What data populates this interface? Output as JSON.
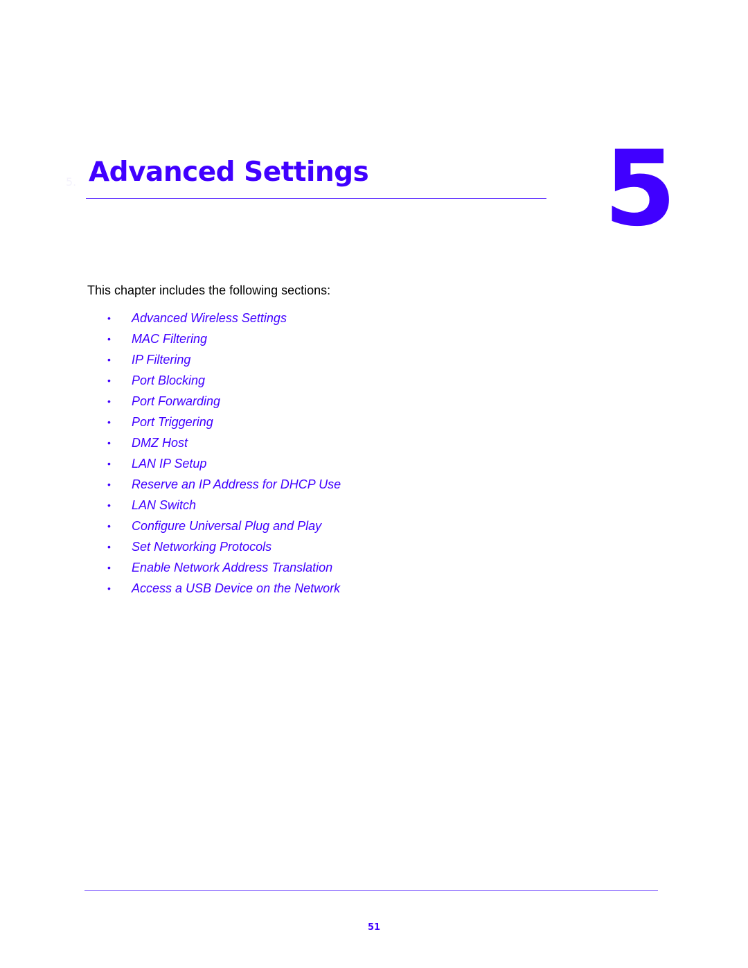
{
  "chapter": {
    "number_label": "5.",
    "title": "Advanced Settings",
    "big_number": "5"
  },
  "intro_text": "This chapter includes the following sections:",
  "toc": [
    {
      "bullet": "•",
      "label": "Advanced Wireless Settings"
    },
    {
      "bullet": "•",
      "label": "MAC Filtering"
    },
    {
      "bullet": "•",
      "label": "IP Filtering"
    },
    {
      "bullet": "•",
      "label": "Port Blocking"
    },
    {
      "bullet": "•",
      "label": "Port Forwarding"
    },
    {
      "bullet": "•",
      "label": "Port Triggering"
    },
    {
      "bullet": "•",
      "label": "DMZ Host"
    },
    {
      "bullet": "•",
      "label": "LAN IP Setup"
    },
    {
      "bullet": "•",
      "label": "Reserve an IP Address for DHCP Use"
    },
    {
      "bullet": "•",
      "label": "LAN Switch"
    },
    {
      "bullet": "•",
      "label": "Configure Universal Plug and Play"
    },
    {
      "bullet": "•",
      "label": "Set Networking Protocols"
    },
    {
      "bullet": "•",
      "label": "Enable Network Address Translation"
    },
    {
      "bullet": "•",
      "label": "Access a USB Device on the Network"
    }
  ],
  "footer": {
    "page_number": "51"
  },
  "colors": {
    "accent": "#4000ff",
    "text": "#000000"
  }
}
